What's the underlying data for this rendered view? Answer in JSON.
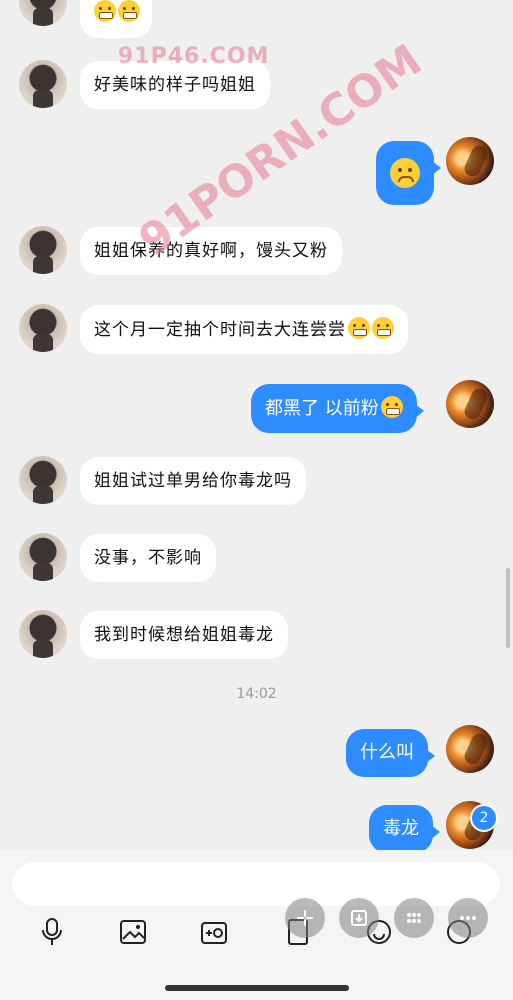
{
  "watermarks": {
    "top": "91P46.COM",
    "diagonal": "91PORN.COM"
  },
  "messages": [
    {
      "side": "left",
      "text": "好美味的样子吗姐姐",
      "emojis": 0
    },
    {
      "side": "right",
      "text": "",
      "emojis": 1
    },
    {
      "side": "left",
      "text": "姐姐保养的真好啊，馒头又粉",
      "emojis": 0
    },
    {
      "side": "left",
      "text": "这个月一定抽个时间去大连尝尝",
      "emojis": 2
    },
    {
      "side": "right",
      "text": "都黑了 以前粉",
      "emojis": 1
    },
    {
      "side": "left",
      "text": "姐姐试过单男给你毒龙吗",
      "emojis": 0
    },
    {
      "side": "left",
      "text": "没事，不影响",
      "emojis": 0
    },
    {
      "side": "left",
      "text": "我到时候想给姐姐毒龙",
      "emojis": 0
    },
    {
      "side": "right",
      "text": "什么叫",
      "emojis": 0
    },
    {
      "side": "right",
      "text": "毒龙",
      "emojis": 0
    }
  ],
  "timestamp": "14:02",
  "unread_badge": "2",
  "composer": {
    "placeholder": "",
    "tools": [
      "microphone-icon",
      "image-icon",
      "camera-icon",
      "file-icon",
      "emoji-icon",
      "plus-icon"
    ],
    "floating_buttons": [
      "sparkle-icon",
      "download-icon",
      "grid-icon",
      "more-icon"
    ]
  }
}
